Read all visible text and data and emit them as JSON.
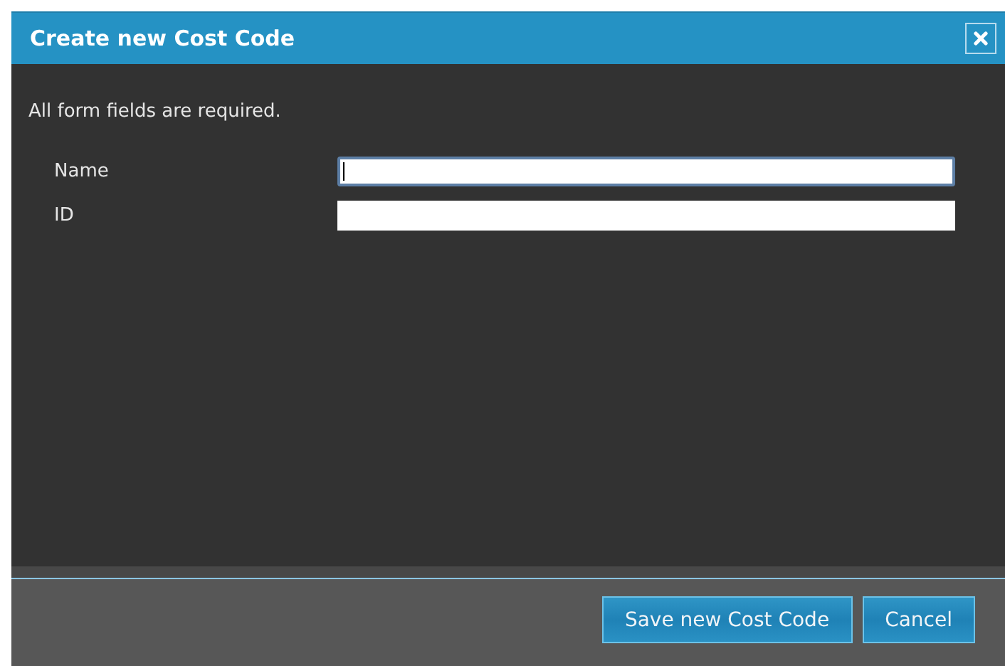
{
  "window": {
    "title": "Create new Cost Code"
  },
  "note": "All form fields are required.",
  "fields": [
    {
      "label": "Name",
      "focused": true
    },
    {
      "label": "ID",
      "focused": false
    }
  ],
  "buttons": [
    "Save new Cost Code",
    "Cancel"
  ]
}
